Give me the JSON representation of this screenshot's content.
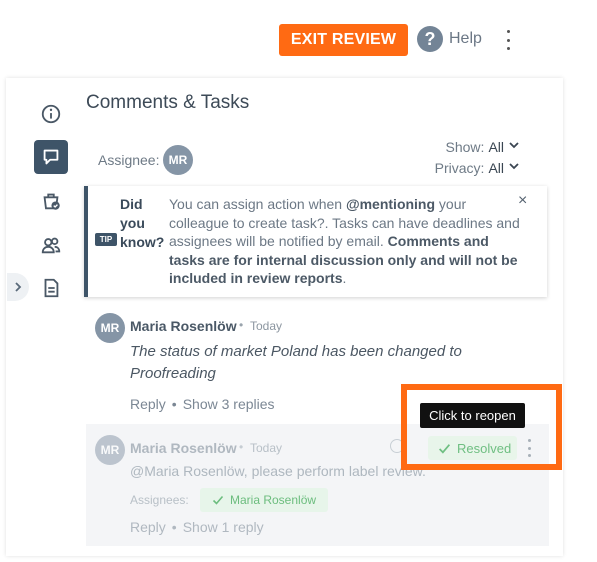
{
  "topbar": {
    "exit_review_label": "EXIT REVIEW",
    "help_label": "Help",
    "help_icon": "?"
  },
  "panel": {
    "title": "Comments & Tasks",
    "assignee_label": "Assignee:",
    "assignee_initials": "MR",
    "show_label": "Show:",
    "show_value": "All",
    "privacy_label": "Privacy:",
    "privacy_value": "All"
  },
  "tip": {
    "badge": "TIP",
    "heading_line1": "Did",
    "heading_line2": "you",
    "heading_line3": "know?",
    "text_prefix": "You can assign action when ",
    "text_mention": "@mentioning",
    "text_middle": " your colleague to create task?. Tasks can have deadlines and assignees will be notified by email. ",
    "text_bold": "Comments and tasks are for internal discussion only and will not be included in review reports",
    "text_suffix": ".",
    "close_icon": "×"
  },
  "comments": [
    {
      "initials": "MR",
      "author": "Maria Rosenlöw",
      "separator": "•",
      "time": "Today",
      "text": "The status of market Poland has been changed to Proofreading",
      "reply_label": "Reply",
      "action_separator": "•",
      "replies_label": "Show 3 replies"
    },
    {
      "initials": "MR",
      "author": "Maria Rosenlöw",
      "separator": "•",
      "time": "Today",
      "text": "@Maria Rosenlöw, please perform label review.",
      "assignees_label": "Assignees:",
      "assignee_name": "Maria Rosenlöw",
      "resolved_label": "Resolved",
      "reply_label": "Reply",
      "action_separator": "•",
      "replies_label": "Show 1 reply"
    }
  ],
  "tooltip": {
    "text": "Click to reopen"
  },
  "colors": {
    "accent_orange": "#ff6a13",
    "navy": "#3e5468",
    "resolved_green": "#6fbf82"
  },
  "icons": {
    "rail": [
      "info-icon",
      "comments-icon",
      "cart-check-icon",
      "users-icon",
      "document-icon"
    ],
    "expand": "chevron-right-icon",
    "resolved_check": "check-icon",
    "assignee_check": "check-icon"
  }
}
